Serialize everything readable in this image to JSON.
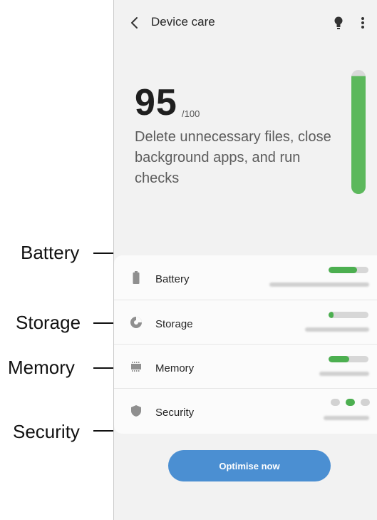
{
  "header": {
    "title": "Device care"
  },
  "score": {
    "value": "95",
    "max": "/100",
    "level": 0.95
  },
  "message": "Delete unnecessary files, close background apps, and run checks",
  "items": [
    {
      "label": "Battery",
      "fill": 0.72
    },
    {
      "label": "Storage",
      "fill": 0.12
    },
    {
      "label": "Memory",
      "fill": 0.52
    },
    {
      "label": "Security"
    }
  ],
  "action": {
    "label": "Optimise now"
  },
  "callouts": [
    "Battery",
    "Storage",
    "Memory",
    "Security"
  ],
  "colors": {
    "accent_blue": "#4b8fd2",
    "status_green": "#4caf50",
    "screen_bg": "#f2f2f2"
  }
}
